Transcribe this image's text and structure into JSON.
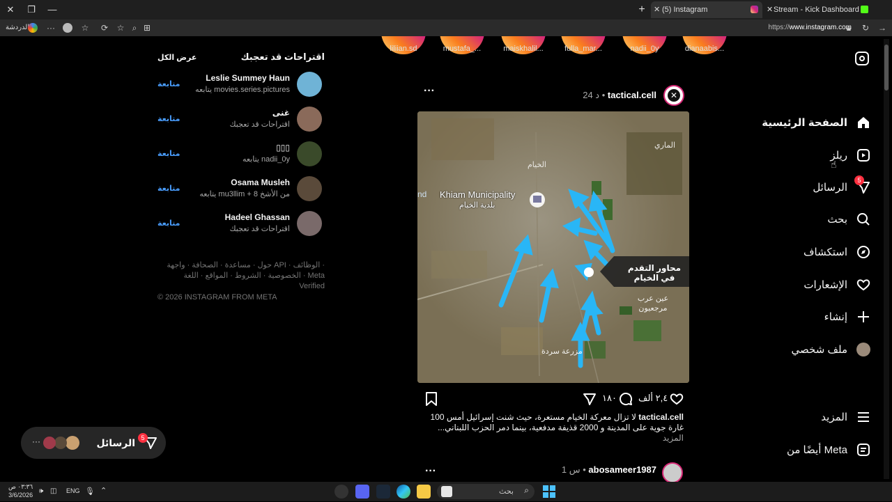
{
  "browser": {
    "tabs": [
      {
        "label": "(5) Instagram",
        "active": true
      },
      {
        "label": "Stream - Kick Dashboard",
        "active": false
      }
    ],
    "chat_label": "الدردشة",
    "url_prefix": "https://",
    "url_host": "www.instagram.com"
  },
  "sidebar": {
    "items": [
      {
        "label": "الصفحة الرئيسية",
        "icon": "home-icon"
      },
      {
        "label": "ريلز",
        "icon": "reels-icon"
      },
      {
        "label": "الرسائل",
        "icon": "messages-icon",
        "badge": "5"
      },
      {
        "label": "بحث",
        "icon": "search-icon"
      },
      {
        "label": "استكشاف",
        "icon": "explore-icon"
      },
      {
        "label": "الإشعارات",
        "icon": "heart-icon"
      },
      {
        "label": "إنشاء",
        "icon": "plus-icon"
      },
      {
        "label": "ملف شخصي",
        "icon": "profile-avatar-icon"
      }
    ],
    "more": "المزيد",
    "also_from_meta": "أيضًا من Meta"
  },
  "stories": [
    "liliian.sd",
    "mustafa_...",
    "maiskhalil...",
    "fulla_mar...",
    "nadii_0y",
    "dianaabis..."
  ],
  "post": {
    "username": "tactical.cell",
    "time": "24 د",
    "map": {
      "place_en": "Khiam Municipality",
      "place_ar": "بلدية الخيام",
      "label_main": "محاور التقدم في الخيام",
      "town_top": "الماري",
      "town_mid": "الخيام",
      "town_right": "عين عرب مرجعيون",
      "town_bottom": "مزرعة سردة",
      "edge_left": "nd"
    },
    "likes": "٢,٤ ألف",
    "comments": "١٨٠",
    "caption_user": "tactical.cell",
    "caption_line1": "لا تزال معركة الخيام مستعرة، حيث شنت إسرائيل أمس 100",
    "caption_line2": "غارة جوية على المدينة و 2000 قذيفة مدفعية، بينما دمر الحزب اللبناني...",
    "caption_more": "المزيد",
    "next_username": "abosameer1987",
    "next_time": "1 س"
  },
  "suggestions": {
    "title": "اقتراحات قد تعجبك",
    "see_all": "عرض الكل",
    "follow_label": "متابعة",
    "items": [
      {
        "name": "Leslie Summey Haun",
        "sub": "يتابعه movies.series.pictures",
        "color": "#6fb3d6"
      },
      {
        "name": "غنى",
        "sub": "اقتراحات قد تعجبك",
        "color": "#8a6a5a"
      },
      {
        "name": "▯▯▯",
        "sub": "يتابعه nadii_0y",
        "color": "#3a4a2a"
      },
      {
        "name": "Osama Musleh",
        "sub": "يتابعه mu3llim + 8 من الأشخ",
        "color": "#5a4a3a"
      },
      {
        "name": "Hadeel Ghassan",
        "sub": "اقتراحات قد تعجبك",
        "color": "#7a6a6a"
      }
    ],
    "footer_line1": "حول · مساعدة · الصحافة · واجهة API · الوظائف ·",
    "footer_line2": "الخصوصية · الشروط · المواقع · اللغة · Meta Verified",
    "copyright": "© 2026 INSTAGRAM FROM META"
  },
  "messages_pill": {
    "label": "الرسائل",
    "badge": "5",
    "dots": "···"
  },
  "taskbar": {
    "time": "٠٣:٣٦ ص",
    "date": "3/6/2026",
    "lang": "ENG",
    "search_placeholder": "بحث"
  }
}
